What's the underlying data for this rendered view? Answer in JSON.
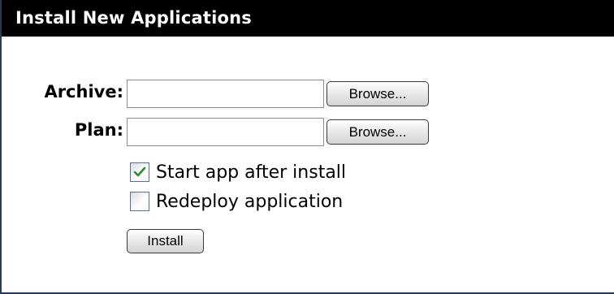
{
  "panel": {
    "title": "Install New Applications"
  },
  "form": {
    "archive_label": "Archive:",
    "archive_value": "",
    "plan_label": "Plan:",
    "plan_value": "",
    "browse_label": "Browse...",
    "start_app_label": "Start app after install",
    "start_app_checked": true,
    "redeploy_label": "Redeploy application",
    "redeploy_checked": false,
    "install_label": "Install"
  },
  "icons": {
    "check": "check-icon"
  },
  "colors": {
    "title_bar": "#000000",
    "checkmark": "#2e8b3a",
    "border": "#2b3a55"
  }
}
